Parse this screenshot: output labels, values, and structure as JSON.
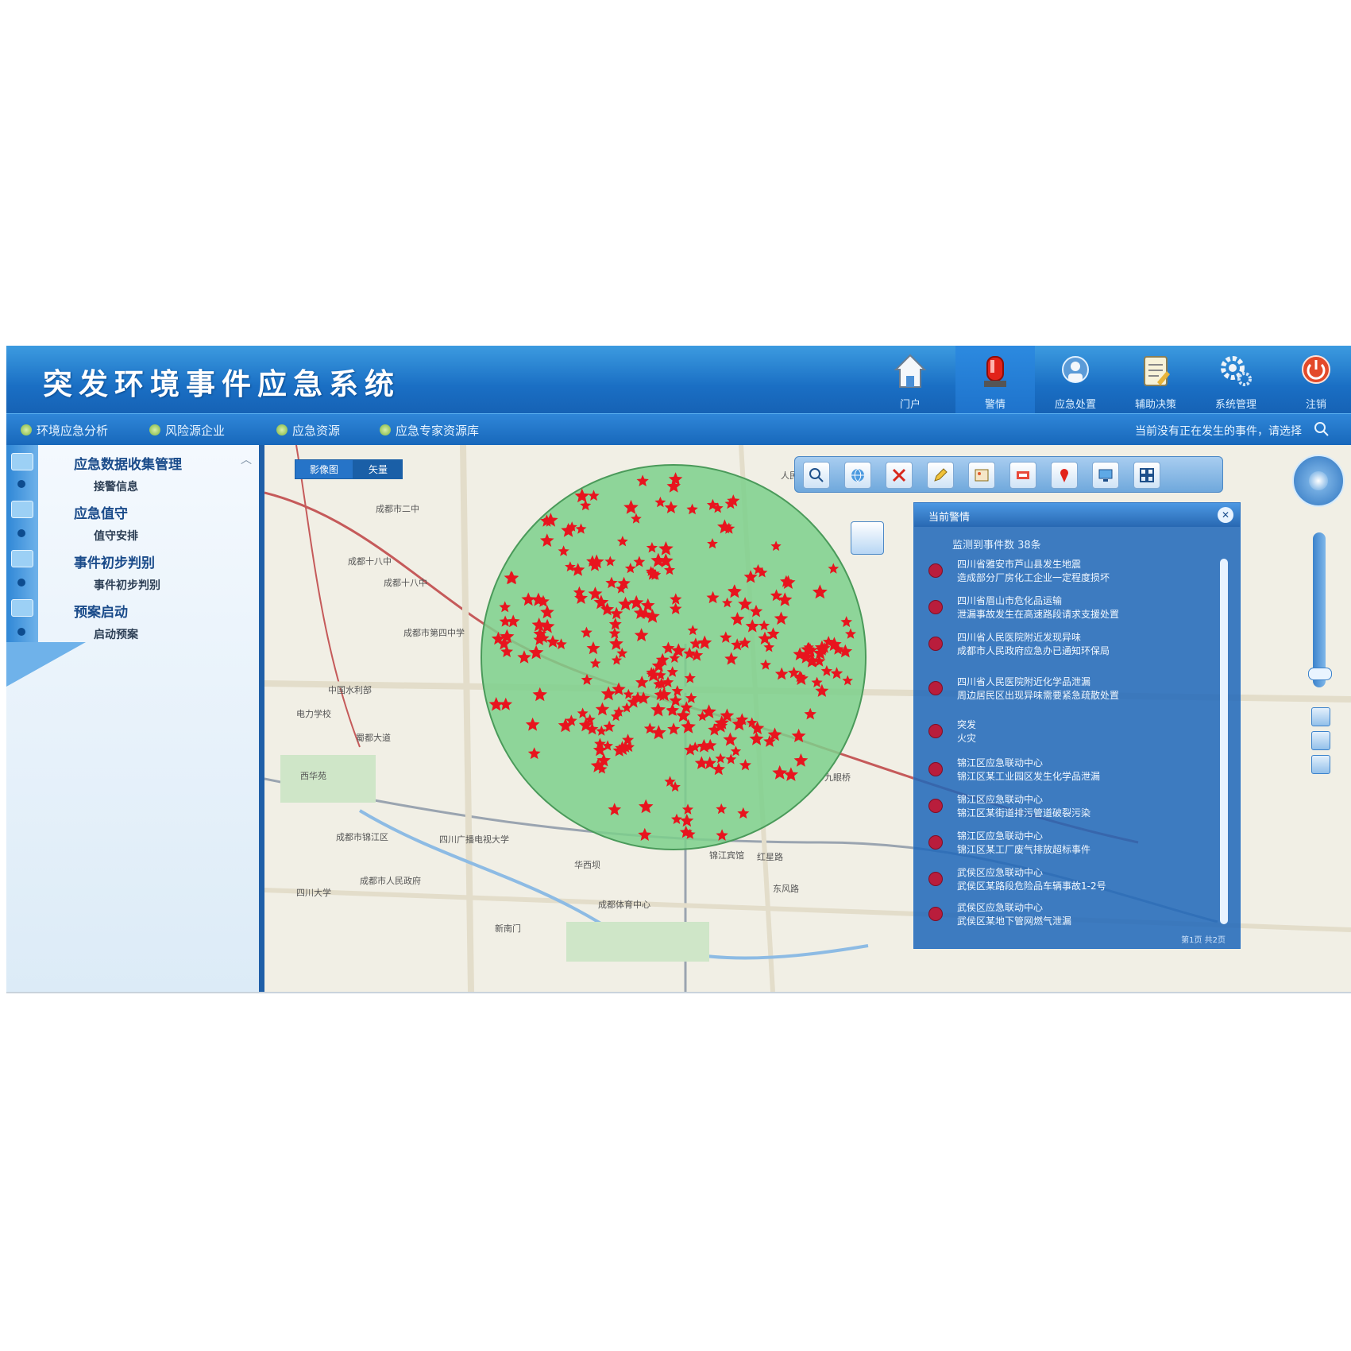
{
  "app": {
    "title": "突发环境事件应急系统"
  },
  "nav": [
    {
      "label": "门户",
      "icon": "house-icon"
    },
    {
      "label": "警情",
      "icon": "alarm-siren-icon",
      "active": true
    },
    {
      "label": "应急处置",
      "icon": "dispatch-icon"
    },
    {
      "label": "辅助决策",
      "icon": "clipboard-icon"
    },
    {
      "label": "系统管理",
      "icon": "gears-icon"
    },
    {
      "label": "注销",
      "icon": "power-icon"
    }
  ],
  "subnav": {
    "tabs": [
      "环境应急分析",
      "风险源企业",
      "应急资源",
      "应急专家资源库"
    ],
    "notice": "当前没有正在发生的事件，请选择"
  },
  "sidebar": {
    "groups": [
      {
        "title": "应急数据收集管理",
        "items": [
          "接警信息"
        ]
      },
      {
        "title": "应急值守",
        "items": [
          "值守安排"
        ]
      },
      {
        "title": "事件初步判别",
        "items": [
          "事件初步判别"
        ]
      },
      {
        "title": "预案启动",
        "items": [
          "启动预案"
        ]
      }
    ]
  },
  "map": {
    "layer_toggle": [
      "影像图",
      "矢量"
    ],
    "radius_area_color": "#7dd08c",
    "incident_marker_color": "#e8141e",
    "labels": [
      "成都市二中",
      "人民北路",
      "成都十八中",
      "成都十八中",
      "成都市第四中学",
      "中国水利部",
      "电力学校",
      "蜀都大道",
      "西华苑",
      "四川广播电视大学",
      "成都市锦江区",
      "锦江宾馆",
      "华西坝",
      "四川大学",
      "成都市人民政府",
      "红星路",
      "东风路",
      "九眼桥",
      "成都体育中心",
      "新南门"
    ]
  },
  "toolbar": {
    "tools": [
      "zoom-in-icon",
      "globe-icon",
      "clear-icon",
      "draw-icon",
      "image-icon",
      "measure-icon",
      "marker-icon",
      "screen-icon",
      "grid-icon"
    ]
  },
  "info_panel": {
    "title": "当前警情",
    "summary": "监测到事件数 38条",
    "events": [
      {
        "line1": "四川省雅安市芦山县发生地震",
        "line2": "造成部分厂房化工企业一定程度损坏"
      },
      {
        "line1": "四川省眉山市危化品运输",
        "line2": "泄漏事故发生在高速路段请求支援处置"
      },
      {
        "line1": "四川省人民医院附近发现异味",
        "line2": "成都市人民政府应急办已通知环保局"
      },
      {
        "line1": "四川省人民医院附近化学品泄漏",
        "line2": "周边居民区出现异味需要紧急疏散处置"
      },
      {
        "line1": "突发",
        "line2": "火灾"
      },
      {
        "line1": "锦江区应急联动中心",
        "line2": "锦江区某工业园区发生化学品泄漏"
      },
      {
        "line1": "锦江区应急联动中心",
        "line2": "锦江区某街道排污管道破裂污染"
      },
      {
        "line1": "锦江区应急联动中心",
        "line2": "锦江区某工厂废气排放超标事件"
      },
      {
        "line1": "武侯区应急联动中心",
        "line2": "武侯区某路段危险品车辆事故1-2号"
      },
      {
        "line1": "武侯区应急联动中心",
        "line2": "武侯区某地下管网燃气泄漏"
      }
    ],
    "footer": "第1页 共2页"
  }
}
